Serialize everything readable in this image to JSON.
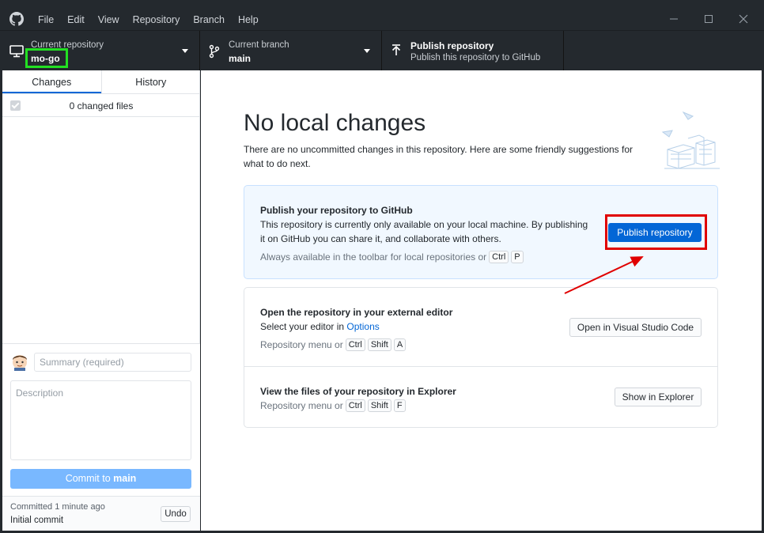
{
  "menu": [
    "File",
    "Edit",
    "View",
    "Repository",
    "Branch",
    "Help"
  ],
  "toolbar": {
    "repo_label": "Current repository",
    "repo_value": "mo-go",
    "branch_label": "Current branch",
    "branch_value": "main",
    "publish_label": "Publish repository",
    "publish_sub": "Publish this repository to GitHub"
  },
  "sidebar": {
    "tabs": [
      "Changes",
      "History"
    ],
    "changed_files": "0 changed files",
    "summary_placeholder": "Summary (required)",
    "description_placeholder": "Description",
    "commit_prefix": "Commit to ",
    "commit_branch": "main",
    "last_commit_time": "Committed 1 minute ago",
    "last_commit_msg": "Initial commit",
    "undo": "Undo"
  },
  "main": {
    "title": "No local changes",
    "subtitle": "There are no uncommitted changes in this repository. Here are some friendly suggestions for what to do next.",
    "publish_card": {
      "heading": "Publish your repository to GitHub",
      "desc": "This repository is currently only available on your local machine. By publishing it on GitHub you can share it, and collaborate with others.",
      "hint": "Always available in the toolbar for local repositories or",
      "keys": [
        "Ctrl",
        "P"
      ],
      "button": "Publish repository"
    },
    "editor_card": {
      "heading": "Open the repository in your external editor",
      "desc_prefix": "Select your editor in ",
      "desc_link": "Options",
      "hint": "Repository menu or",
      "keys": [
        "Ctrl",
        "Shift",
        "A"
      ],
      "button": "Open in Visual Studio Code"
    },
    "explorer_card": {
      "heading": "View the files of your repository in Explorer",
      "hint": "Repository menu or",
      "keys": [
        "Ctrl",
        "Shift",
        "F"
      ],
      "button": "Show in Explorer"
    }
  },
  "colors": {
    "accent": "#0366d6",
    "highlight_green": "#22e022",
    "highlight_red": "#e00000"
  }
}
